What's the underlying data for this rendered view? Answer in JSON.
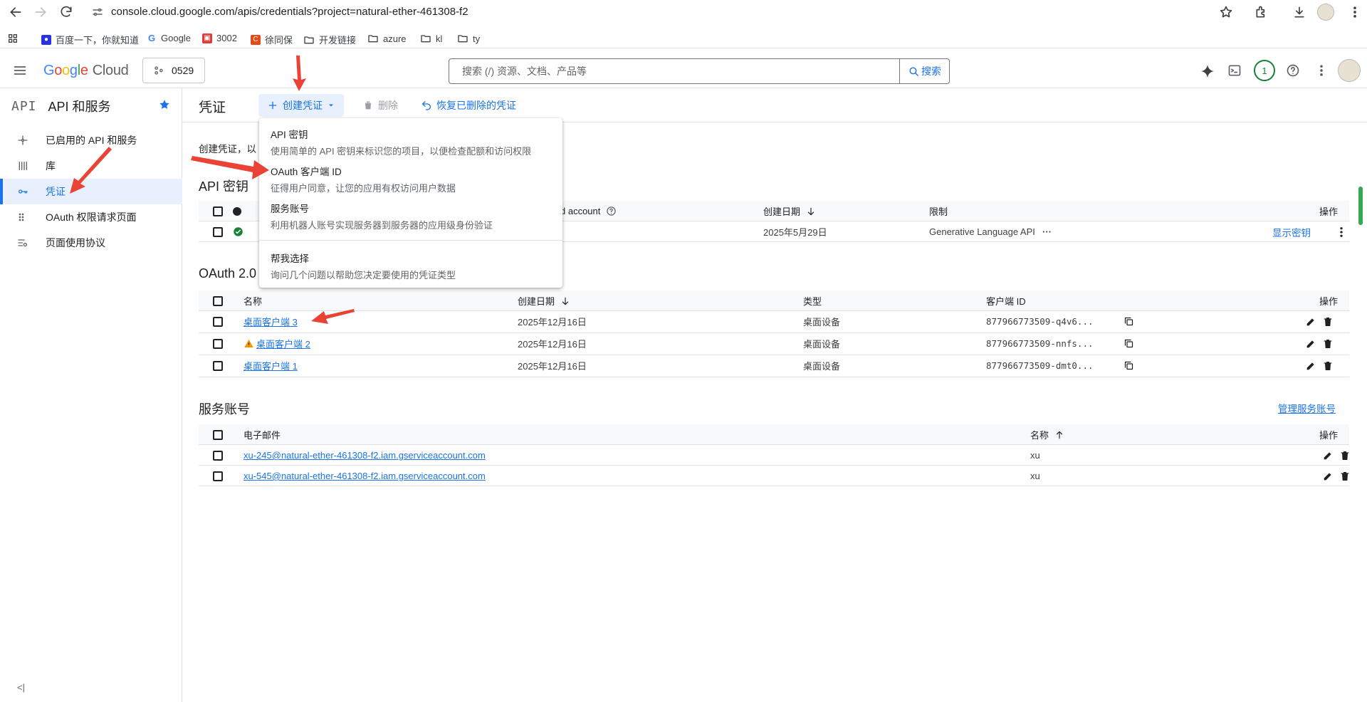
{
  "browser": {
    "url": "console.cloud.google.com/apis/credentials?project=natural-ether-461308-f2",
    "bookmarks": [
      "百度一下，你就知道",
      "Google",
      "3002",
      "徐同保",
      "开发链接",
      "azure",
      "kl",
      "ty"
    ]
  },
  "header": {
    "logo_letters": [
      "G",
      "o",
      "o",
      "g",
      "l",
      "e"
    ],
    "logo_cloud": "Cloud",
    "project": "0529",
    "search_placeholder": "搜索 (/) 资源、文档、产品等",
    "search_button": "搜索",
    "notification_count": "1"
  },
  "sidebar": {
    "mark": "API",
    "title": "API 和服务",
    "items": [
      {
        "label": "已启用的 API 和服务",
        "icon": "dashboard-icon"
      },
      {
        "label": "库",
        "icon": "library-icon"
      },
      {
        "label": "凭证",
        "icon": "key-icon",
        "active": true
      },
      {
        "label": "OAuth 权限请求页面",
        "icon": "oauth-icon"
      },
      {
        "label": "页面使用协议",
        "icon": "settings-list-icon"
      }
    ],
    "collapse": "<|"
  },
  "toolbar": {
    "title": "凭证",
    "create": "创建凭证",
    "delete": "删除",
    "restore": "恢复已删除的凭证"
  },
  "intro": "创建凭证，以",
  "dropdown": {
    "items": [
      {
        "title": "API 密钥",
        "subtitle": "使用简单的 API 密钥来标识您的项目，以便检查配额和访问权限"
      },
      {
        "title": "OAuth 客户端 ID",
        "subtitle": "征得用户同意，让您的应用有权访问用户数据"
      },
      {
        "title": "服务账号",
        "subtitle": "利用机器人账号实现服务器到服务器的应用级身份验证"
      },
      {
        "title": "帮我选择",
        "subtitle": "询问几个问题以帮助您决定要使用的凭证类型"
      }
    ]
  },
  "api_keys": {
    "title": "API 密钥",
    "headers": {
      "name_tail": "d account",
      "created": "创建日期",
      "restriction": "限制",
      "actions": "操作"
    },
    "rows": [
      {
        "created": "2025年5月29日",
        "restriction": "Generative Language API",
        "more": "···",
        "action": "显示密钥"
      }
    ]
  },
  "oauth": {
    "title": "OAuth 2.0",
    "headers": {
      "name": "名称",
      "created": "创建日期",
      "type": "类型",
      "client_id": "客户端 ID",
      "actions": "操作"
    },
    "rows": [
      {
        "name": "桌面客户端 3",
        "created": "2025年12月16日",
        "type": "桌面设备",
        "client_id": "877966773509-q4v6...",
        "warning": false
      },
      {
        "name": "桌面客户端 2",
        "created": "2025年12月16日",
        "type": "桌面设备",
        "client_id": "877966773509-nnfs...",
        "warning": true
      },
      {
        "name": "桌面客户端 1",
        "created": "2025年12月16日",
        "type": "桌面设备",
        "client_id": "877966773509-dmt0...",
        "warning": false
      }
    ]
  },
  "service_accounts": {
    "title": "服务账号",
    "manage": "管理服务账号",
    "headers": {
      "email": "电子邮件",
      "name": "名称",
      "actions": "操作"
    },
    "rows": [
      {
        "email": "xu-245@natural-ether-461308-f2.iam.gserviceaccount.com",
        "name": "xu"
      },
      {
        "email": "xu-545@natural-ether-461308-f2.iam.gserviceaccount.com",
        "name": "xu"
      }
    ]
  },
  "colors": {
    "accent": "#1a73e8",
    "annotation": "#ea4335",
    "success": "#188038",
    "warning": "#f29900"
  }
}
